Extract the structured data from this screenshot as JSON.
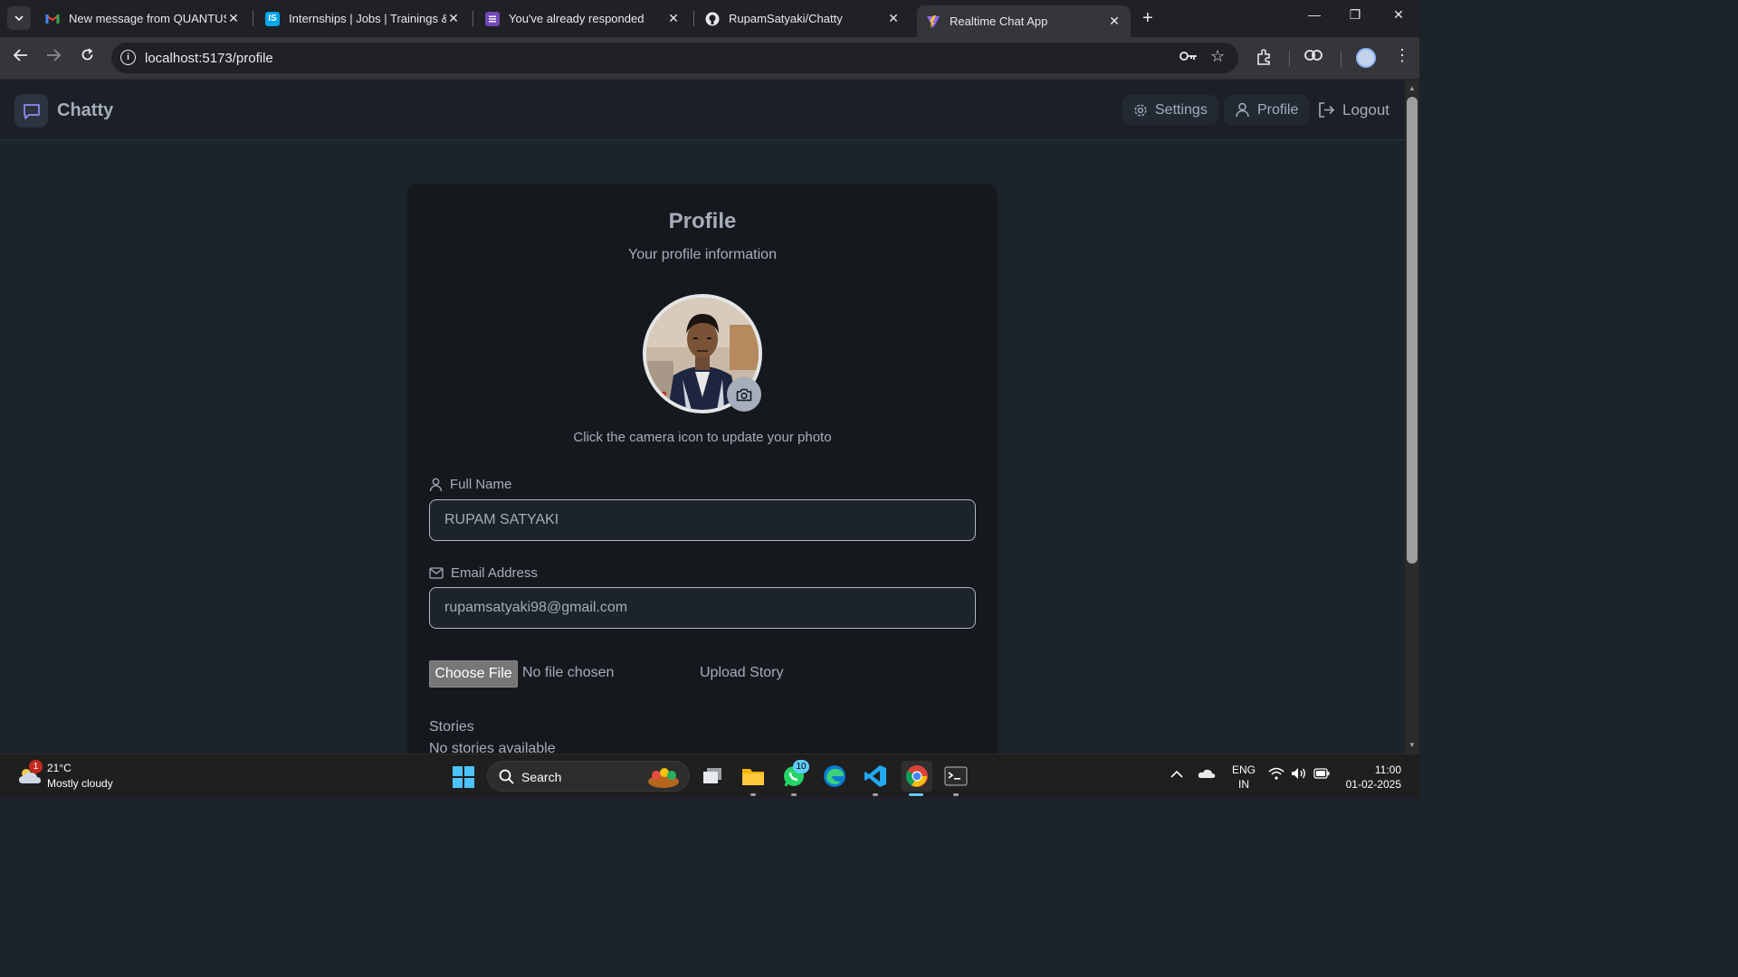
{
  "browser": {
    "tabs": [
      {
        "title": "New message from QUANTUS S",
        "icon": "gmail-icon",
        "active": false
      },
      {
        "title": "Internships | Jobs | Trainings & I",
        "icon": "internshala-icon",
        "active": false
      },
      {
        "title": "You've already responded",
        "icon": "forms-icon",
        "active": false
      },
      {
        "title": "RupamSatyaki/Chatty",
        "icon": "github-icon",
        "active": false
      },
      {
        "title": "Realtime Chat App",
        "icon": "vite-icon",
        "active": true
      }
    ],
    "url": "localhost:5173/profile"
  },
  "app": {
    "brand": "Chatty",
    "nav": {
      "settings": "Settings",
      "profile": "Profile",
      "logout": "Logout"
    },
    "profile": {
      "title": "Profile",
      "subtitle": "Your profile information",
      "photo_hint": "Click the camera icon to update your photo",
      "full_name_label": "Full Name",
      "full_name_value": "RUPAM SATYAKI",
      "email_label": "Email Address",
      "email_value": "rupamsatyaki98@gmail.com",
      "choose_file_label": "Choose File",
      "no_file_text": "No file chosen",
      "upload_story_label": "Upload Story",
      "stories_title": "Stories",
      "stories_empty": "No stories available"
    }
  },
  "taskbar": {
    "weather_badge": "1",
    "temperature": "21°C",
    "weather": "Mostly cloudy",
    "search_placeholder": "Search",
    "whatsapp_badge": "10",
    "lang_line1": "ENG",
    "lang_line2": "IN",
    "time": "11:00",
    "date": "01-02-2025"
  },
  "colors": {
    "page_bg": "#1d232a",
    "card_bg": "#15191e",
    "text": "#a6adbb",
    "accent": "#60cdff"
  }
}
